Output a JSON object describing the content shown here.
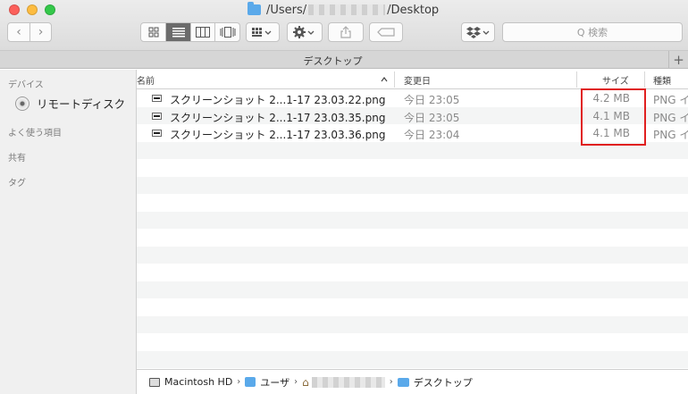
{
  "window": {
    "title_prefix": "/Users/",
    "title_suffix": "/Desktop"
  },
  "toolbar": {
    "back_icon": "‹",
    "forward_icon": "›",
    "search_placeholder": "Q 検索"
  },
  "tab": {
    "title": "デスクトップ",
    "add_label": "+"
  },
  "sidebar": {
    "sections": [
      {
        "title": "デバイス"
      },
      {
        "title": "よく使う項目"
      },
      {
        "title": "共有"
      },
      {
        "title": "タグ"
      }
    ],
    "device_item": "リモートディスク"
  },
  "columns": {
    "name": "名前",
    "modified": "変更日",
    "size": "サイズ",
    "kind": "種類"
  },
  "files": [
    {
      "name": "スクリーンショット 2...1-17 23.03.22.png",
      "modified": "今日 23:05",
      "size": "4.2 MB",
      "kind": "PNG イ"
    },
    {
      "name": "スクリーンショット 2...1-17 23.03.35.png",
      "modified": "今日 23:05",
      "size": "4.1 MB",
      "kind": "PNG イ"
    },
    {
      "name": "スクリーンショット 2...1-17 23.03.36.png",
      "modified": "今日 23:04",
      "size": "4.1 MB",
      "kind": "PNG イ"
    }
  ],
  "pathbar": {
    "disk": "Macintosh HD",
    "users": "ユーザ",
    "desktop": "デスクトップ"
  },
  "colors": {
    "highlight": "#e02020",
    "folder": "#5aa9ea"
  }
}
